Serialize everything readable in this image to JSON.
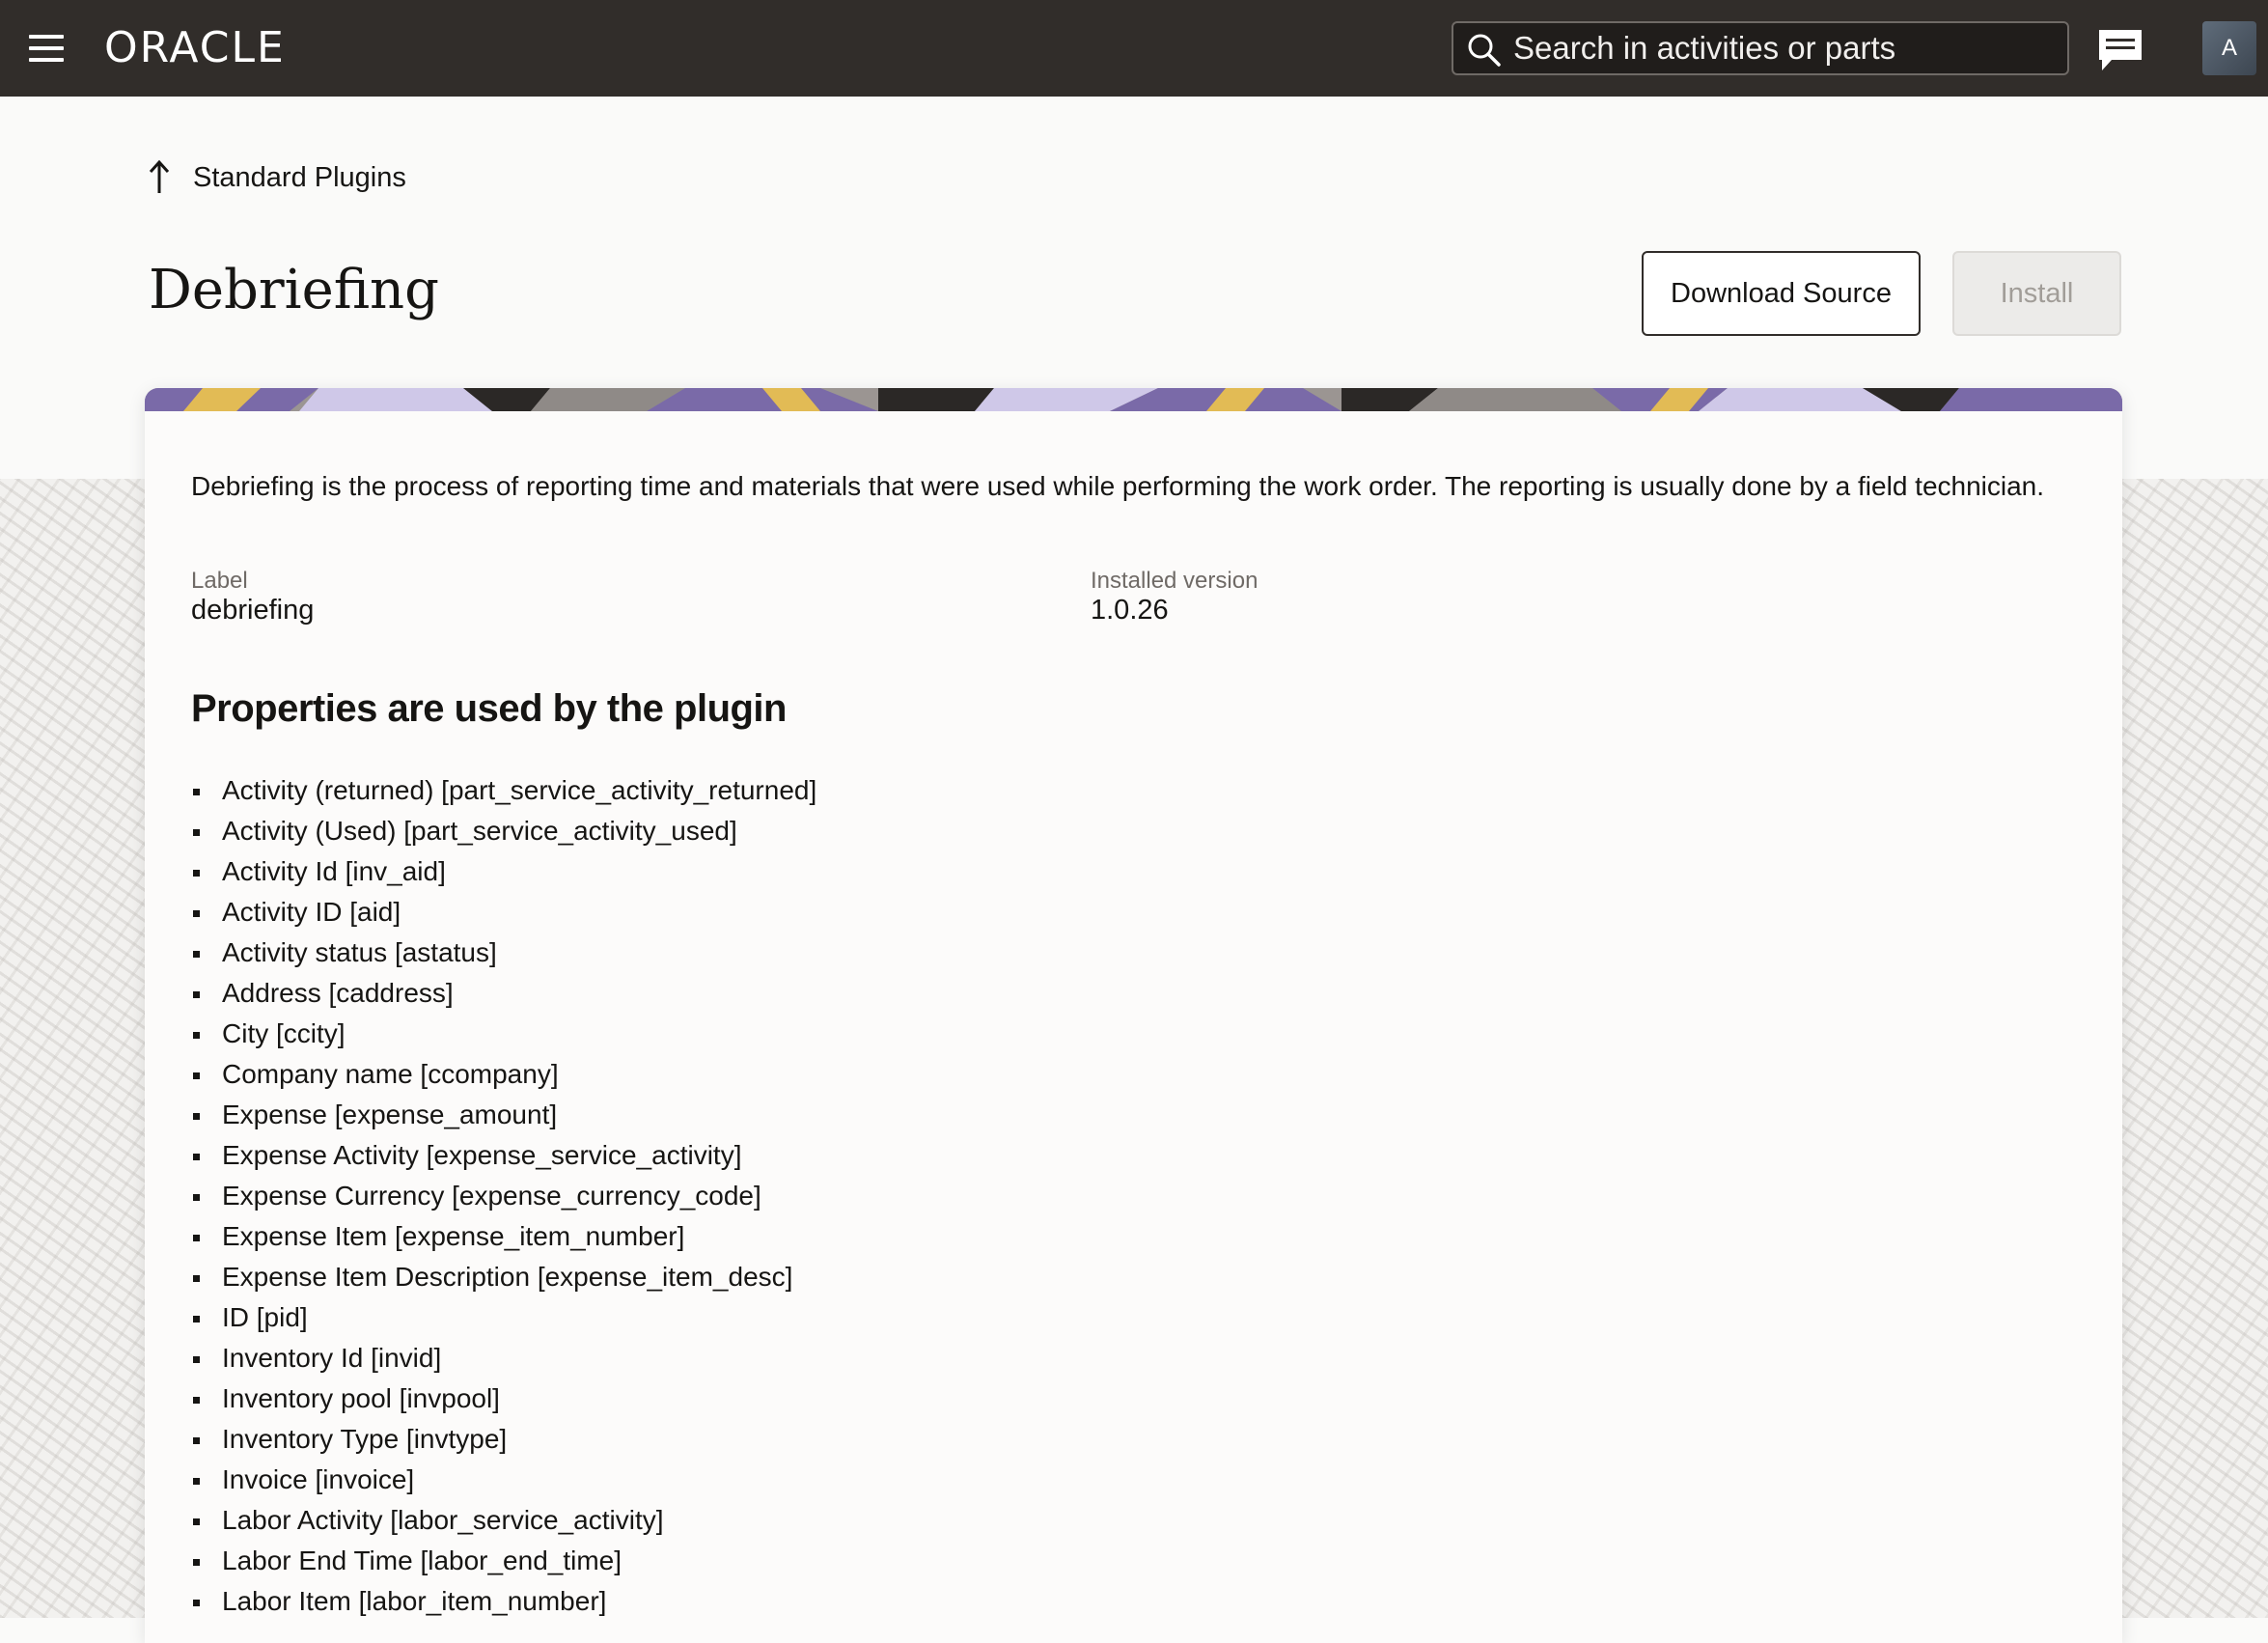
{
  "header": {
    "logo_text": "ORACLE",
    "search_placeholder": "Search in activities or parts",
    "avatar_initial": "A"
  },
  "breadcrumb": {
    "label": "Standard Plugins"
  },
  "page": {
    "title": "Debriefing",
    "download_label": "Download Source",
    "install_label": "Install"
  },
  "details": {
    "description": "Debriefing is the process of reporting time and materials that were used while performing the work order. The reporting is usually done by a field technician.",
    "label_caption": "Label",
    "label_value": "debriefing",
    "version_caption": "Installed version",
    "version_value": "1.0.26"
  },
  "properties": {
    "title": "Properties are used by the plugin",
    "items": [
      "Activity (returned) [part_service_activity_returned]",
      "Activity (Used) [part_service_activity_used]",
      "Activity Id [inv_aid]",
      "Activity ID [aid]",
      "Activity status [astatus]",
      "Address [caddress]",
      "City [ccity]",
      "Company name [ccompany]",
      "Expense [expense_amount]",
      "Expense Activity [expense_service_activity]",
      "Expense Currency [expense_currency_code]",
      "Expense Item [expense_item_number]",
      "Expense Item Description [expense_item_desc]",
      "ID [pid]",
      "Inventory Id [invid]",
      "Inventory pool [invpool]",
      "Inventory Type [invtype]",
      "Invoice [invoice]",
      "Labor Activity [labor_service_activity]",
      "Labor End Time [labor_end_time]",
      "Labor Item [labor_item_number]"
    ]
  },
  "colors": {
    "header_bg": "#312d2a",
    "banner_purple": "#7a6aa8",
    "banner_yellow": "#e2bb55"
  }
}
